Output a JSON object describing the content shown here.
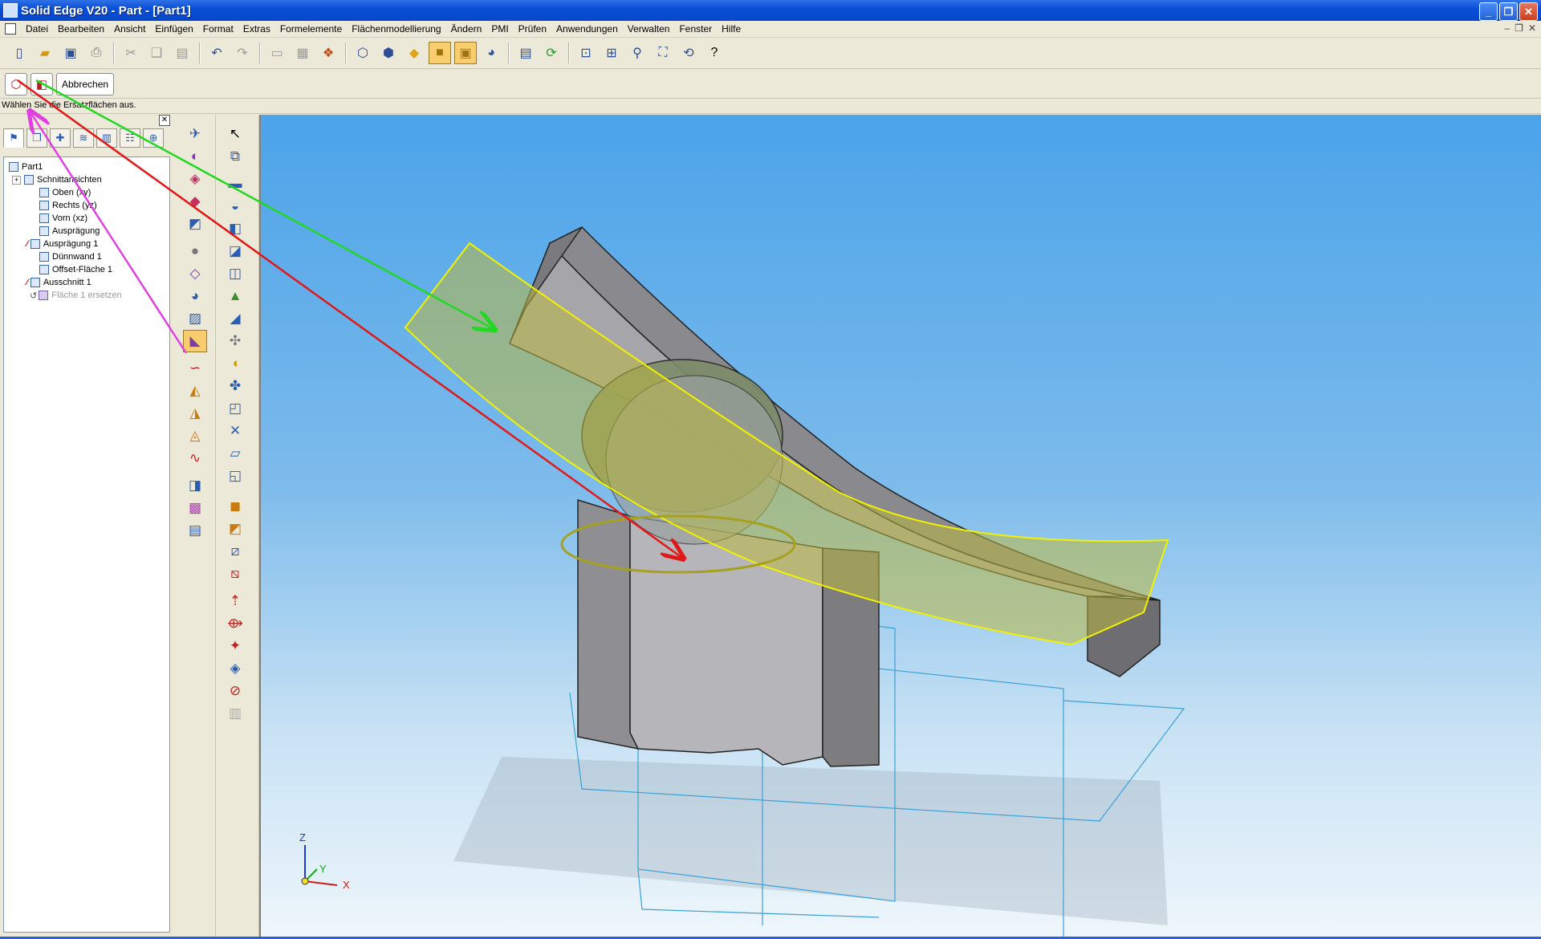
{
  "window": {
    "title": "Solid Edge V20 - Part - [Part1]",
    "buttons": [
      "_",
      "❐",
      "✕"
    ]
  },
  "menu": {
    "items": [
      "Datei",
      "Bearbeiten",
      "Ansicht",
      "Einfügen",
      "Format",
      "Extras",
      "Formelemente",
      "Flächenmodellierung",
      "Ändern",
      "PMI",
      "Prüfen",
      "Anwendungen",
      "Verwalten",
      "Fenster",
      "Hilfe"
    ],
    "mdi_buttons": [
      "–",
      "❐",
      "✕"
    ]
  },
  "main_toolbar": {
    "icons": [
      "new-icon",
      "open-icon",
      "save-icon",
      "print-icon",
      "cut-icon",
      "copy-icon",
      "paste-icon",
      "undo-icon",
      "redo-icon",
      "properties-icon",
      "select-tool-icon",
      "parts-icon",
      "iso-view-icon",
      "dimetric-view-icon",
      "shaded-icon",
      "shaded-edges-icon",
      "visible-edges-icon",
      "sphere-view-icon",
      "view-styles-icon",
      "rotate-icon",
      "zoom-area-icon",
      "pan-icon",
      "zoom-icon",
      "fit-icon",
      "spin-icon",
      "help-icon"
    ]
  },
  "command_bar": {
    "cancel_label": "Abbrechen"
  },
  "prompt": {
    "text": "Wählen Sie die Ersatzflächen aus."
  },
  "pathfinder": {
    "close_label": "✕",
    "tree": [
      {
        "label": "Part1",
        "level": 0,
        "expander": "",
        "error": false,
        "dim": false
      },
      {
        "label": "Schnittansichten",
        "level": 1,
        "expander": "+",
        "error": false,
        "dim": false
      },
      {
        "label": "Oben (xy)",
        "level": 2,
        "expander": "",
        "error": false,
        "dim": false
      },
      {
        "label": "Rechts (yz)",
        "level": 2,
        "expander": "",
        "error": false,
        "dim": false
      },
      {
        "label": "Vorn (xz)",
        "level": 2,
        "expander": "",
        "error": false,
        "dim": false
      },
      {
        "label": "Ausprägung",
        "level": 2,
        "expander": "",
        "error": false,
        "dim": false
      },
      {
        "label": "Ausprägung 1",
        "level": 2,
        "expander": "",
        "error": true,
        "dim": false
      },
      {
        "label": "Dünnwand 1",
        "level": 2,
        "expander": "",
        "error": false,
        "dim": false
      },
      {
        "label": "Offset-Fläche 1",
        "level": 2,
        "expander": "",
        "error": false,
        "dim": false
      },
      {
        "label": "Ausschnitt 1",
        "level": 2,
        "expander": "",
        "error": true,
        "dim": false
      },
      {
        "label": "Fläche 1 ersetzen",
        "level": 2,
        "expander": "",
        "error": false,
        "dim": true
      }
    ]
  },
  "viewport": {
    "axis_labels": {
      "z": "Z",
      "y": "Y",
      "x": "X"
    },
    "colors": {
      "body": "#8e8e8e",
      "surface": "#bcb842",
      "edge": "#f2f200",
      "sketch": "#3aa0d8",
      "arrow_green": "#22d822",
      "arrow_red": "#e01818",
      "arrow_magenta": "#e040e0"
    }
  }
}
